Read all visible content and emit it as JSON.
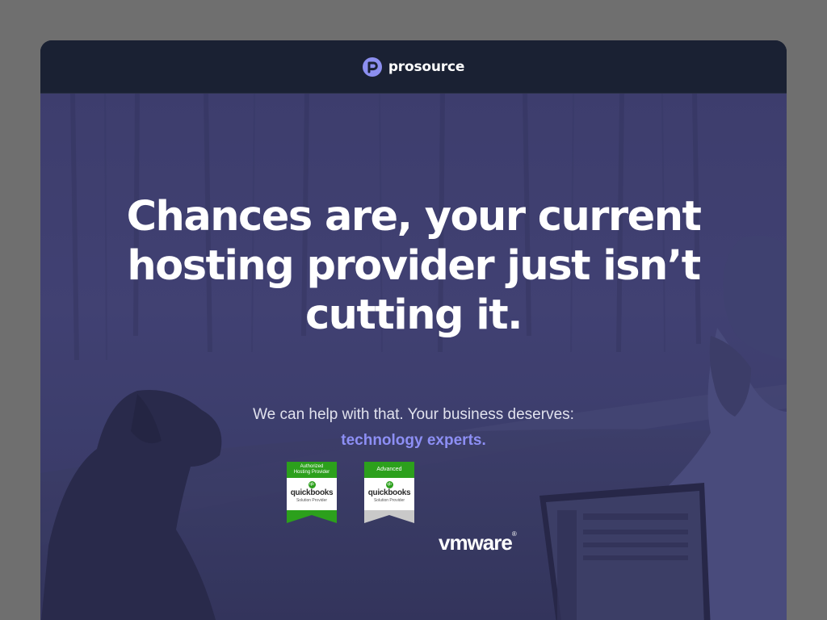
{
  "brand": {
    "name": "prosource",
    "logo_icon": "prosource-p-logo",
    "accent": "#8c8ff0"
  },
  "hero": {
    "headline_line1": "Chances are, your current",
    "headline_line2": "hosting provider just isn’t",
    "headline_line3": "cutting it.",
    "subline": "We can help with that. Your business deserves:",
    "highlight": "technology experts.",
    "highlight_color": "#8d8ff5"
  },
  "badges": [
    {
      "band_line1": "Authorized",
      "band_line2": "Hosting Provider",
      "product": "quickbooks",
      "caption": "Solution Provider",
      "tail_color": "#2ca01c"
    },
    {
      "band_line1": "Advanced",
      "product": "quickbooks",
      "caption": "Solution Provider",
      "tail_color": "#c9c9c9"
    }
  ],
  "partner": {
    "name": "vmware",
    "mark": "®"
  }
}
